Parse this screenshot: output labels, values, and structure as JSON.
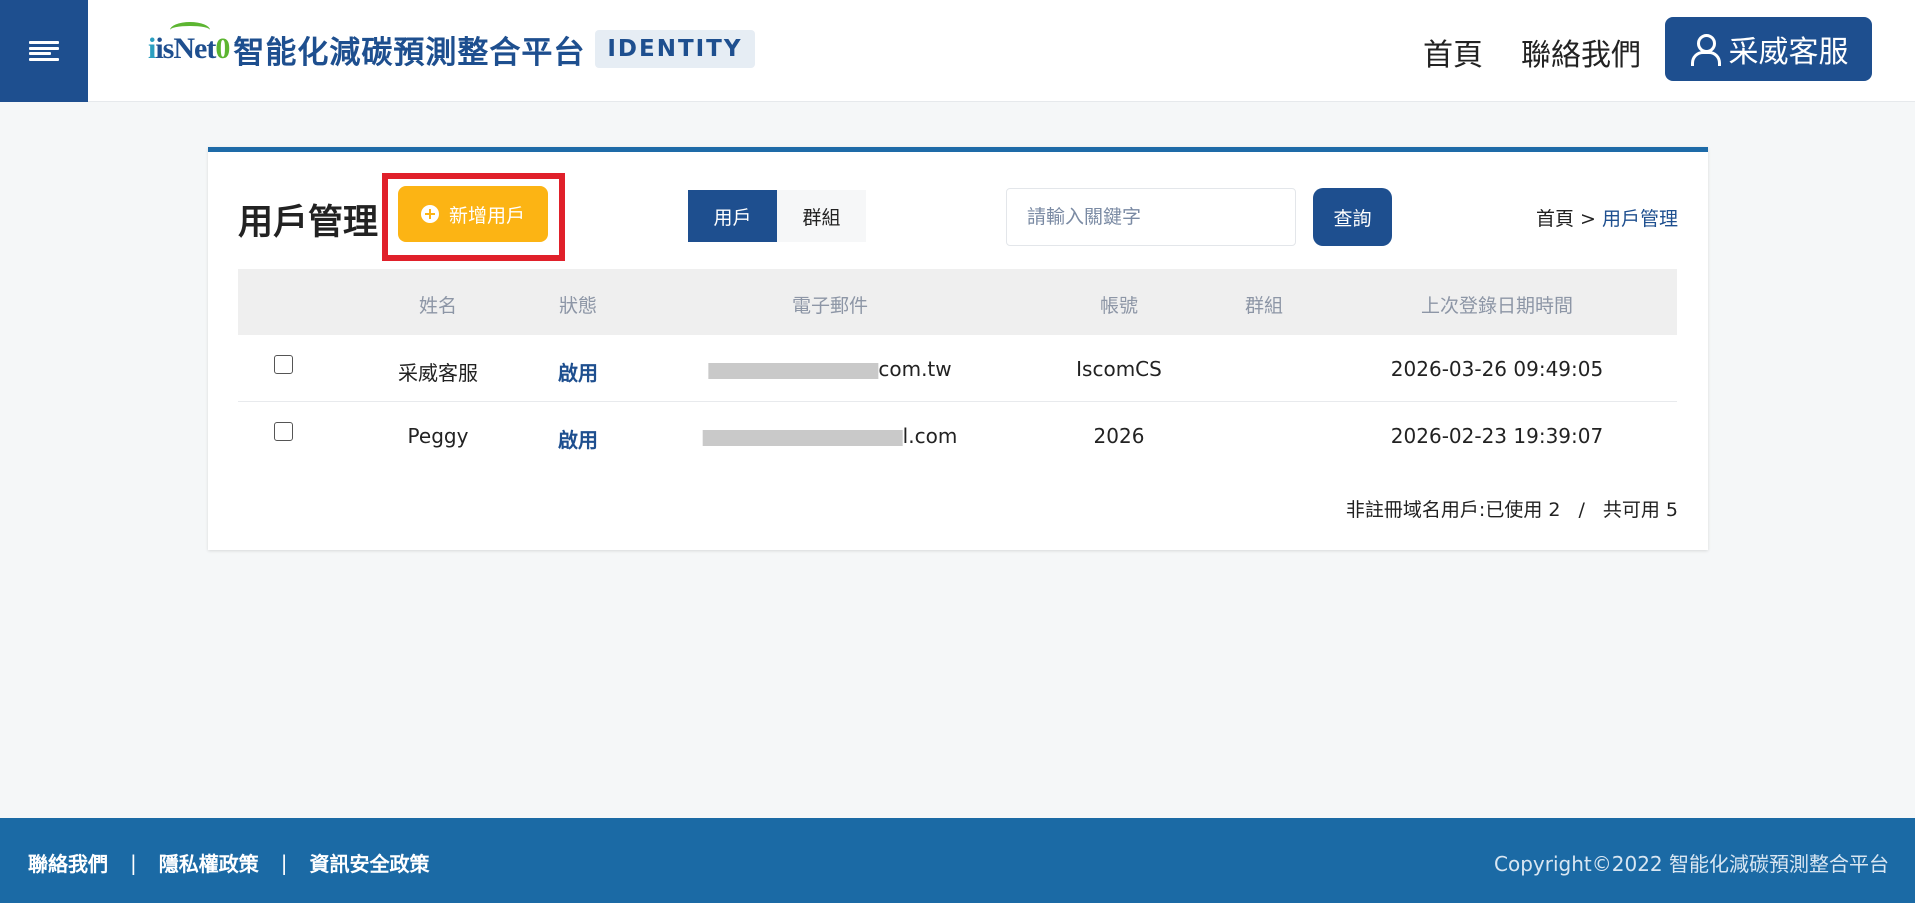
{
  "header": {
    "logo_prefix": "isNet",
    "logo_suffix": "0",
    "title": "智能化減碳預測整合平台",
    "tag": "IDENTITY",
    "nav": {
      "home": "首頁",
      "contact": "聯絡我們"
    },
    "user_label": "采威客服"
  },
  "page": {
    "title": "用戶管理",
    "add_button": "新增用戶",
    "tabs": [
      {
        "label": "用戶",
        "active": true
      },
      {
        "label": "群組",
        "active": false
      }
    ],
    "search_placeholder": "請輸入關鍵字",
    "search_button": "查詢",
    "breadcrumb": {
      "home": "首頁",
      "separator": ">",
      "current": "用戶管理"
    }
  },
  "table": {
    "columns": [
      "姓名",
      "狀態",
      "電子郵件",
      "帳號",
      "群組",
      "上次登錄日期時間"
    ],
    "rows": [
      {
        "name": "采威客服",
        "status": "啟用",
        "email_visible": "com.tw",
        "account": "IscomCS",
        "group": "",
        "last_login": "2026-03-26 09:49:05"
      },
      {
        "name": "Peggy",
        "status": "啟用",
        "email_visible": "l.com",
        "account": "2026",
        "group": "",
        "last_login": "2026-02-23 19:39:07"
      }
    ]
  },
  "quota": {
    "used": "非註冊域名用戶:已使用 2",
    "separator": "/",
    "total": "共可用 5"
  },
  "footer": {
    "links": [
      "聯絡我們",
      "隱私權政策",
      "資訊安全政策"
    ],
    "divider": "|",
    "copyright": "Copyright©2022 智能化減碳預測整合平台"
  },
  "colors": {
    "primary": "#1e4f8f",
    "accent": "#fcb414",
    "highlight": "#e0202a",
    "footer": "#1b6aa5"
  }
}
